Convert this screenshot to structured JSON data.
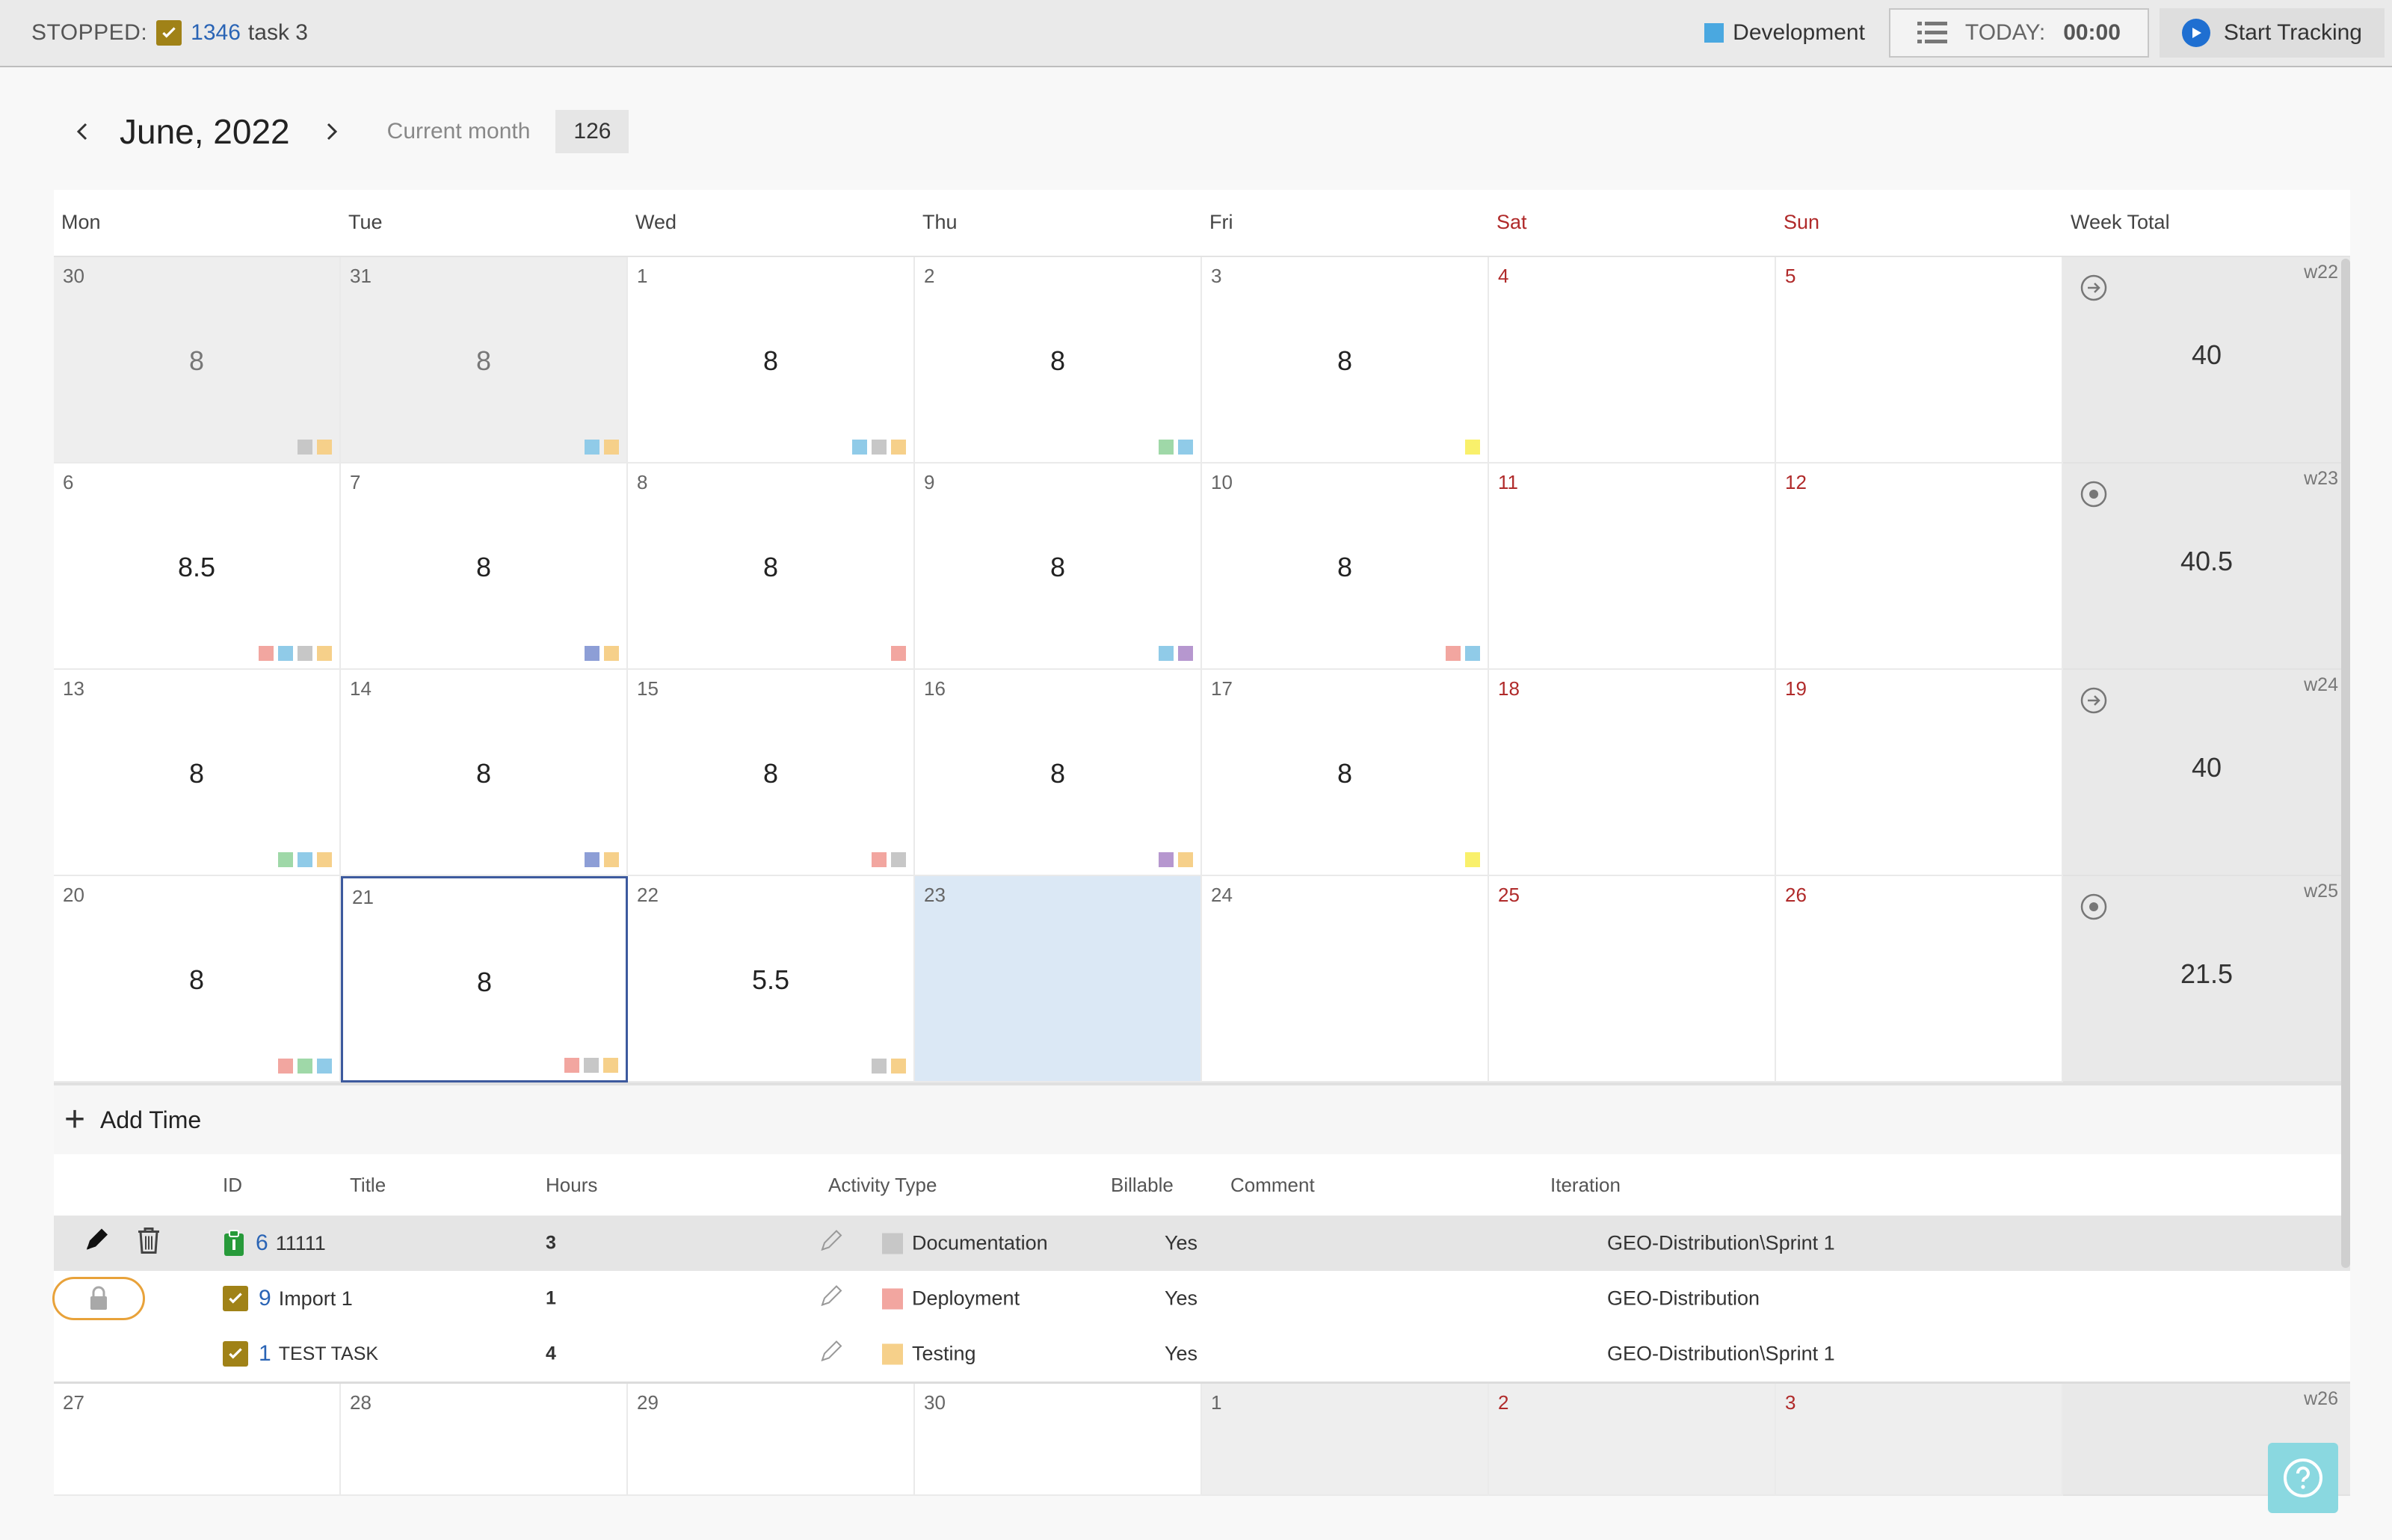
{
  "topbar": {
    "status_label": "STOPPED:",
    "task_id": "1346",
    "task_name": "task 3",
    "area_label": "Development",
    "area_color": "#4aa8e0",
    "today_label": "TODAY:",
    "today_time": "00:00",
    "start_label": "Start Tracking"
  },
  "month": {
    "title": "June, 2022",
    "current_label": "Current month",
    "total": "126"
  },
  "days_of_week": [
    "Mon",
    "Tue",
    "Wed",
    "Thu",
    "Fri",
    "Sat",
    "Sun",
    "Week Total"
  ],
  "colors": {
    "gray": "#c7c7c7",
    "orange": "#f6d08a",
    "blue": "#90cbe8",
    "green": "#9fd8a8",
    "red": "#f2a6a0",
    "navy": "#8d9ed6",
    "purple": "#b697cf",
    "yellow": "#f9f06b"
  },
  "weeks": [
    {
      "label": "w22",
      "total": "40",
      "icon": "arrow-circle-icon",
      "days": [
        {
          "n": "30",
          "h": "8",
          "other": true,
          "chips": [
            "gray",
            "orange"
          ]
        },
        {
          "n": "31",
          "h": "8",
          "other": true,
          "chips": [
            "blue",
            "orange"
          ]
        },
        {
          "n": "1",
          "h": "8",
          "chips": [
            "blue",
            "gray",
            "orange"
          ]
        },
        {
          "n": "2",
          "h": "8",
          "chips": [
            "green",
            "blue"
          ]
        },
        {
          "n": "3",
          "h": "8",
          "chips": [
            "yellow"
          ]
        },
        {
          "n": "4",
          "h": "",
          "chips": []
        },
        {
          "n": "5",
          "h": "",
          "chips": []
        }
      ]
    },
    {
      "label": "w23",
      "total": "40.5",
      "icon": "target-circle-icon",
      "days": [
        {
          "n": "6",
          "h": "8.5",
          "chips": [
            "red",
            "blue",
            "gray",
            "orange"
          ]
        },
        {
          "n": "7",
          "h": "8",
          "chips": [
            "navy",
            "orange"
          ]
        },
        {
          "n": "8",
          "h": "8",
          "chips": [
            "red"
          ]
        },
        {
          "n": "9",
          "h": "8",
          "chips": [
            "blue",
            "purple"
          ]
        },
        {
          "n": "10",
          "h": "8",
          "chips": [
            "red",
            "blue"
          ]
        },
        {
          "n": "11",
          "h": "",
          "chips": []
        },
        {
          "n": "12",
          "h": "",
          "chips": []
        }
      ]
    },
    {
      "label": "w24",
      "total": "40",
      "icon": "arrow-circle-icon",
      "days": [
        {
          "n": "13",
          "h": "8",
          "chips": [
            "green",
            "blue",
            "orange"
          ]
        },
        {
          "n": "14",
          "h": "8",
          "chips": [
            "navy",
            "orange"
          ]
        },
        {
          "n": "15",
          "h": "8",
          "chips": [
            "red",
            "gray"
          ]
        },
        {
          "n": "16",
          "h": "8",
          "chips": [
            "purple",
            "orange"
          ]
        },
        {
          "n": "17",
          "h": "8",
          "chips": [
            "yellow"
          ]
        },
        {
          "n": "18",
          "h": "",
          "chips": []
        },
        {
          "n": "19",
          "h": "",
          "chips": []
        }
      ]
    },
    {
      "label": "w25",
      "total": "21.5",
      "icon": "target-circle-icon",
      "days": [
        {
          "n": "20",
          "h": "8",
          "chips": [
            "red",
            "green",
            "blue"
          ]
        },
        {
          "n": "21",
          "h": "8",
          "selected": true,
          "chips": [
            "red",
            "gray",
            "orange"
          ]
        },
        {
          "n": "22",
          "h": "5.5",
          "chips": [
            "gray",
            "orange"
          ]
        },
        {
          "n": "23",
          "h": "",
          "today": true,
          "chips": []
        },
        {
          "n": "24",
          "h": "",
          "chips": []
        },
        {
          "n": "25",
          "h": "",
          "chips": []
        },
        {
          "n": "26",
          "h": "",
          "chips": []
        }
      ]
    }
  ],
  "detail": {
    "add_label": "Add Time",
    "columns": [
      "ID",
      "Title",
      "Hours",
      "Activity Type",
      "Billable",
      "Comment",
      "Iteration"
    ],
    "rows": [
      {
        "id": "6",
        "title": "11111",
        "hours": "3",
        "activity": "Documentation",
        "activity_color": "#c7c7c7",
        "billable": "Yes",
        "comment": "",
        "iteration": "GEO-Distribution\\Sprint 1",
        "kind": "task-green"
      },
      {
        "id": "9",
        "title": "Import 1",
        "hours": "1",
        "activity": "Deployment",
        "activity_color": "#f2a6a0",
        "billable": "Yes",
        "comment": "",
        "iteration": "GEO-Distribution",
        "kind": "check"
      },
      {
        "id": "1",
        "title": "TEST TASK",
        "hours": "4",
        "activity": "Testing",
        "activity_color": "#f6d08a",
        "billable": "Yes",
        "comment": "",
        "iteration": "GEO-Distribution\\Sprint 1",
        "kind": "check"
      }
    ]
  },
  "last_week": {
    "label": "w26",
    "days": [
      {
        "n": "27",
        "other": false
      },
      {
        "n": "28",
        "other": false
      },
      {
        "n": "29",
        "other": false
      },
      {
        "n": "30",
        "other": false
      },
      {
        "n": "1",
        "other": true
      },
      {
        "n": "2",
        "other": true
      },
      {
        "n": "3",
        "other": true
      }
    ]
  }
}
